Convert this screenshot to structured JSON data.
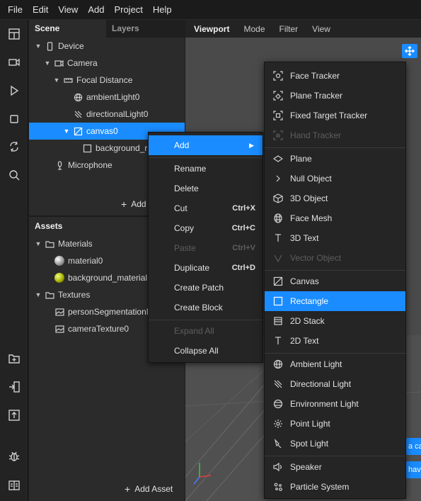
{
  "menubar": {
    "items": [
      "File",
      "Edit",
      "View",
      "Add",
      "Project",
      "Help"
    ]
  },
  "toolbar": {
    "icons": [
      "layout-icon",
      "camera-icon",
      "play-icon",
      "stop-icon",
      "sync-icon",
      "search-icon",
      "new-folder-icon",
      "import-icon",
      "export-icon",
      "bug-icon",
      "console-icon"
    ]
  },
  "scene": {
    "tabs": [
      "Scene",
      "Layers"
    ],
    "tree": [
      {
        "label": "Device"
      },
      {
        "label": "Camera"
      },
      {
        "label": "Focal Distance"
      },
      {
        "label": "ambientLight0"
      },
      {
        "label": "directionalLight0"
      },
      {
        "label": "canvas0"
      },
      {
        "label": "background_rec"
      },
      {
        "label": "Microphone"
      }
    ],
    "add_label": "Add"
  },
  "assets": {
    "title": "Assets",
    "tree": [
      {
        "label": "Materials"
      },
      {
        "label": "material0"
      },
      {
        "label": "background_material"
      },
      {
        "label": "Textures"
      },
      {
        "label": "personSegmentationM"
      },
      {
        "label": "cameraTexture0"
      }
    ],
    "add_asset_label": "Add Asset"
  },
  "viewport": {
    "tabs": [
      "Viewport",
      "Mode",
      "Filter",
      "View"
    ],
    "tips": [
      "a ca",
      "hav"
    ]
  },
  "context_menu": {
    "items": [
      {
        "label": "Add",
        "shortcut": ""
      },
      {
        "label": "Rename",
        "shortcut": ""
      },
      {
        "label": "Delete",
        "shortcut": ""
      },
      {
        "label": "Cut",
        "shortcut": "Ctrl+X"
      },
      {
        "label": "Copy",
        "shortcut": "Ctrl+C"
      },
      {
        "label": "Paste",
        "shortcut": "Ctrl+V"
      },
      {
        "label": "Duplicate",
        "shortcut": "Ctrl+D"
      },
      {
        "label": "Create Patch",
        "shortcut": ""
      },
      {
        "label": "Create Block",
        "shortcut": ""
      },
      {
        "label": "Expand All",
        "shortcut": ""
      },
      {
        "label": "Collapse All",
        "shortcut": ""
      }
    ]
  },
  "add_submenu": {
    "items": [
      {
        "label": "Face Tracker",
        "icon": "face-tracker-icon"
      },
      {
        "label": "Plane Tracker",
        "icon": "plane-tracker-icon"
      },
      {
        "label": "Fixed Target Tracker",
        "icon": "target-tracker-icon"
      },
      {
        "label": "Hand Tracker",
        "icon": "hand-tracker-icon"
      },
      {
        "label": "Plane",
        "icon": "plane-icon"
      },
      {
        "label": "Null Object",
        "icon": "null-object-icon"
      },
      {
        "label": "3D Object",
        "icon": "cube-icon"
      },
      {
        "label": "Face Mesh",
        "icon": "face-mesh-icon"
      },
      {
        "label": "3D Text",
        "icon": "text-3d-icon"
      },
      {
        "label": "Vector Object",
        "icon": "vector-object-icon"
      },
      {
        "label": "Canvas",
        "icon": "canvas-icon"
      },
      {
        "label": "Rectangle",
        "icon": "rectangle-icon"
      },
      {
        "label": "2D Stack",
        "icon": "stack-icon"
      },
      {
        "label": "2D Text",
        "icon": "text-2d-icon"
      },
      {
        "label": "Ambient Light",
        "icon": "ambient-light-icon"
      },
      {
        "label": "Directional Light",
        "icon": "directional-light-icon"
      },
      {
        "label": "Environment Light",
        "icon": "environment-light-icon"
      },
      {
        "label": "Point Light",
        "icon": "point-light-icon"
      },
      {
        "label": "Spot Light",
        "icon": "spot-light-icon"
      },
      {
        "label": "Speaker",
        "icon": "speaker-icon"
      },
      {
        "label": "Particle System",
        "icon": "particle-system-icon"
      }
    ]
  },
  "colors": {
    "accent": "#1a8cff",
    "panel": "#2b2b2b",
    "menu": "#252525",
    "disabled": "#5e5e5e"
  }
}
